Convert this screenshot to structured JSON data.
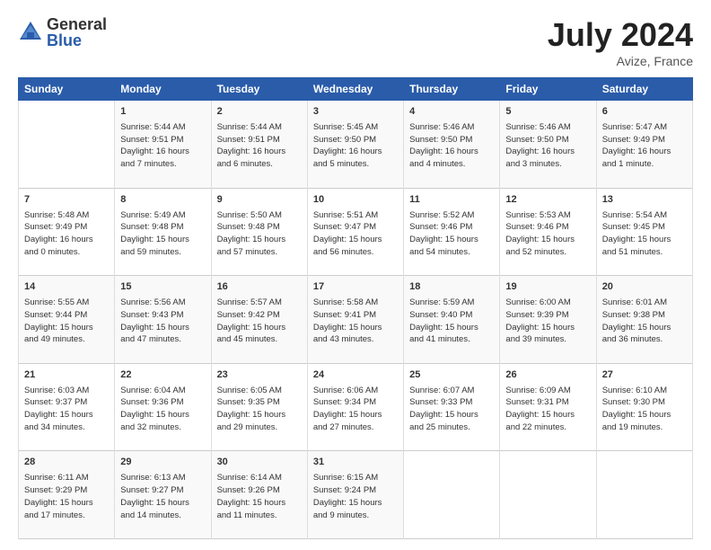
{
  "logo": {
    "general": "General",
    "blue": "Blue"
  },
  "title": {
    "month_year": "July 2024",
    "location": "Avize, France"
  },
  "weekdays": [
    "Sunday",
    "Monday",
    "Tuesday",
    "Wednesday",
    "Thursday",
    "Friday",
    "Saturday"
  ],
  "weeks": [
    [
      {
        "day": "",
        "sunrise": "",
        "sunset": "",
        "daylight": ""
      },
      {
        "day": "1",
        "sunrise": "Sunrise: 5:44 AM",
        "sunset": "Sunset: 9:51 PM",
        "daylight": "Daylight: 16 hours and 7 minutes."
      },
      {
        "day": "2",
        "sunrise": "Sunrise: 5:44 AM",
        "sunset": "Sunset: 9:51 PM",
        "daylight": "Daylight: 16 hours and 6 minutes."
      },
      {
        "day": "3",
        "sunrise": "Sunrise: 5:45 AM",
        "sunset": "Sunset: 9:50 PM",
        "daylight": "Daylight: 16 hours and 5 minutes."
      },
      {
        "day": "4",
        "sunrise": "Sunrise: 5:46 AM",
        "sunset": "Sunset: 9:50 PM",
        "daylight": "Daylight: 16 hours and 4 minutes."
      },
      {
        "day": "5",
        "sunrise": "Sunrise: 5:46 AM",
        "sunset": "Sunset: 9:50 PM",
        "daylight": "Daylight: 16 hours and 3 minutes."
      },
      {
        "day": "6",
        "sunrise": "Sunrise: 5:47 AM",
        "sunset": "Sunset: 9:49 PM",
        "daylight": "Daylight: 16 hours and 1 minute."
      }
    ],
    [
      {
        "day": "7",
        "sunrise": "Sunrise: 5:48 AM",
        "sunset": "Sunset: 9:49 PM",
        "daylight": "Daylight: 16 hours and 0 minutes."
      },
      {
        "day": "8",
        "sunrise": "Sunrise: 5:49 AM",
        "sunset": "Sunset: 9:48 PM",
        "daylight": "Daylight: 15 hours and 59 minutes."
      },
      {
        "day": "9",
        "sunrise": "Sunrise: 5:50 AM",
        "sunset": "Sunset: 9:48 PM",
        "daylight": "Daylight: 15 hours and 57 minutes."
      },
      {
        "day": "10",
        "sunrise": "Sunrise: 5:51 AM",
        "sunset": "Sunset: 9:47 PM",
        "daylight": "Daylight: 15 hours and 56 minutes."
      },
      {
        "day": "11",
        "sunrise": "Sunrise: 5:52 AM",
        "sunset": "Sunset: 9:46 PM",
        "daylight": "Daylight: 15 hours and 54 minutes."
      },
      {
        "day": "12",
        "sunrise": "Sunrise: 5:53 AM",
        "sunset": "Sunset: 9:46 PM",
        "daylight": "Daylight: 15 hours and 52 minutes."
      },
      {
        "day": "13",
        "sunrise": "Sunrise: 5:54 AM",
        "sunset": "Sunset: 9:45 PM",
        "daylight": "Daylight: 15 hours and 51 minutes."
      }
    ],
    [
      {
        "day": "14",
        "sunrise": "Sunrise: 5:55 AM",
        "sunset": "Sunset: 9:44 PM",
        "daylight": "Daylight: 15 hours and 49 minutes."
      },
      {
        "day": "15",
        "sunrise": "Sunrise: 5:56 AM",
        "sunset": "Sunset: 9:43 PM",
        "daylight": "Daylight: 15 hours and 47 minutes."
      },
      {
        "day": "16",
        "sunrise": "Sunrise: 5:57 AM",
        "sunset": "Sunset: 9:42 PM",
        "daylight": "Daylight: 15 hours and 45 minutes."
      },
      {
        "day": "17",
        "sunrise": "Sunrise: 5:58 AM",
        "sunset": "Sunset: 9:41 PM",
        "daylight": "Daylight: 15 hours and 43 minutes."
      },
      {
        "day": "18",
        "sunrise": "Sunrise: 5:59 AM",
        "sunset": "Sunset: 9:40 PM",
        "daylight": "Daylight: 15 hours and 41 minutes."
      },
      {
        "day": "19",
        "sunrise": "Sunrise: 6:00 AM",
        "sunset": "Sunset: 9:39 PM",
        "daylight": "Daylight: 15 hours and 39 minutes."
      },
      {
        "day": "20",
        "sunrise": "Sunrise: 6:01 AM",
        "sunset": "Sunset: 9:38 PM",
        "daylight": "Daylight: 15 hours and 36 minutes."
      }
    ],
    [
      {
        "day": "21",
        "sunrise": "Sunrise: 6:03 AM",
        "sunset": "Sunset: 9:37 PM",
        "daylight": "Daylight: 15 hours and 34 minutes."
      },
      {
        "day": "22",
        "sunrise": "Sunrise: 6:04 AM",
        "sunset": "Sunset: 9:36 PM",
        "daylight": "Daylight: 15 hours and 32 minutes."
      },
      {
        "day": "23",
        "sunrise": "Sunrise: 6:05 AM",
        "sunset": "Sunset: 9:35 PM",
        "daylight": "Daylight: 15 hours and 29 minutes."
      },
      {
        "day": "24",
        "sunrise": "Sunrise: 6:06 AM",
        "sunset": "Sunset: 9:34 PM",
        "daylight": "Daylight: 15 hours and 27 minutes."
      },
      {
        "day": "25",
        "sunrise": "Sunrise: 6:07 AM",
        "sunset": "Sunset: 9:33 PM",
        "daylight": "Daylight: 15 hours and 25 minutes."
      },
      {
        "day": "26",
        "sunrise": "Sunrise: 6:09 AM",
        "sunset": "Sunset: 9:31 PM",
        "daylight": "Daylight: 15 hours and 22 minutes."
      },
      {
        "day": "27",
        "sunrise": "Sunrise: 6:10 AM",
        "sunset": "Sunset: 9:30 PM",
        "daylight": "Daylight: 15 hours and 19 minutes."
      }
    ],
    [
      {
        "day": "28",
        "sunrise": "Sunrise: 6:11 AM",
        "sunset": "Sunset: 9:29 PM",
        "daylight": "Daylight: 15 hours and 17 minutes."
      },
      {
        "day": "29",
        "sunrise": "Sunrise: 6:13 AM",
        "sunset": "Sunset: 9:27 PM",
        "daylight": "Daylight: 15 hours and 14 minutes."
      },
      {
        "day": "30",
        "sunrise": "Sunrise: 6:14 AM",
        "sunset": "Sunset: 9:26 PM",
        "daylight": "Daylight: 15 hours and 11 minutes."
      },
      {
        "day": "31",
        "sunrise": "Sunrise: 6:15 AM",
        "sunset": "Sunset: 9:24 PM",
        "daylight": "Daylight: 15 hours and 9 minutes."
      },
      {
        "day": "",
        "sunrise": "",
        "sunset": "",
        "daylight": ""
      },
      {
        "day": "",
        "sunrise": "",
        "sunset": "",
        "daylight": ""
      },
      {
        "day": "",
        "sunrise": "",
        "sunset": "",
        "daylight": ""
      }
    ]
  ]
}
